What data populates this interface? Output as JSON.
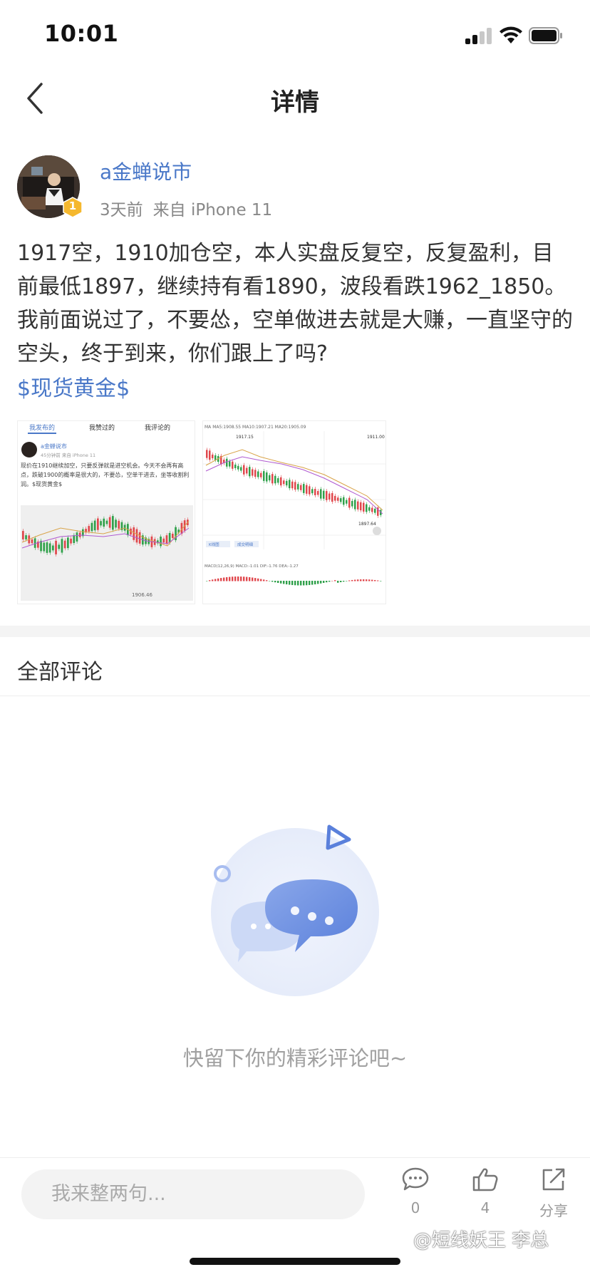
{
  "status_bar": {
    "time": "10:01"
  },
  "nav": {
    "title": "详情"
  },
  "post": {
    "author": "a金蝉说市",
    "level": "1",
    "time_ago": "3天前",
    "source": "来自 iPhone 11",
    "text": "1917空，1910加仓空，本人实盘反复空，反复盈利，目前最低1897，继续持有看1890，波段看跌1962_1850。我前面说过了，不要怂，空单做进去就是大赚，一直坚守的空头，终于到来，你们跟上了吗?",
    "tag": "$现货黄金$"
  },
  "thumb1": {
    "tabs": [
      "我发布的",
      "我赞过的",
      "我评论的"
    ],
    "author": "a金蝉说市",
    "meta": "45分钟前  来自 iPhone 11",
    "text": "现价在1910继续加空，只要反弹就是进空机会。今天不会再有高点，跌破1900的概率是很大的，不要怂，空单干进去，坐等收割利润。$现货黄金$",
    "price_low": "1906.46"
  },
  "thumb2": {
    "top_legend": "MA  MA5:1908.55  MA10:1907.21  MA20:1905.09",
    "price_high": "1917.15",
    "price_right_top": "1911.00",
    "price_low": "1897.64",
    "button_left": "K线图",
    "button_right": "成交明细",
    "macd_legend": "MACD(12,26,9)  MACD:-1.01  DIF:-1.76  DEA:-1.27"
  },
  "comments": {
    "title": "全部评论",
    "empty_text": "快留下你的精彩评论吧~"
  },
  "bottom_bar": {
    "input_placeholder": "我来整两句...",
    "comment_count": "0",
    "like_count": "4",
    "share_label": "分享"
  },
  "watermark": "@短线妖王 李总",
  "colors": {
    "link": "#4a78c8",
    "up": "#e0474c",
    "down": "#2fa04a",
    "badge": "#f5b82e"
  }
}
